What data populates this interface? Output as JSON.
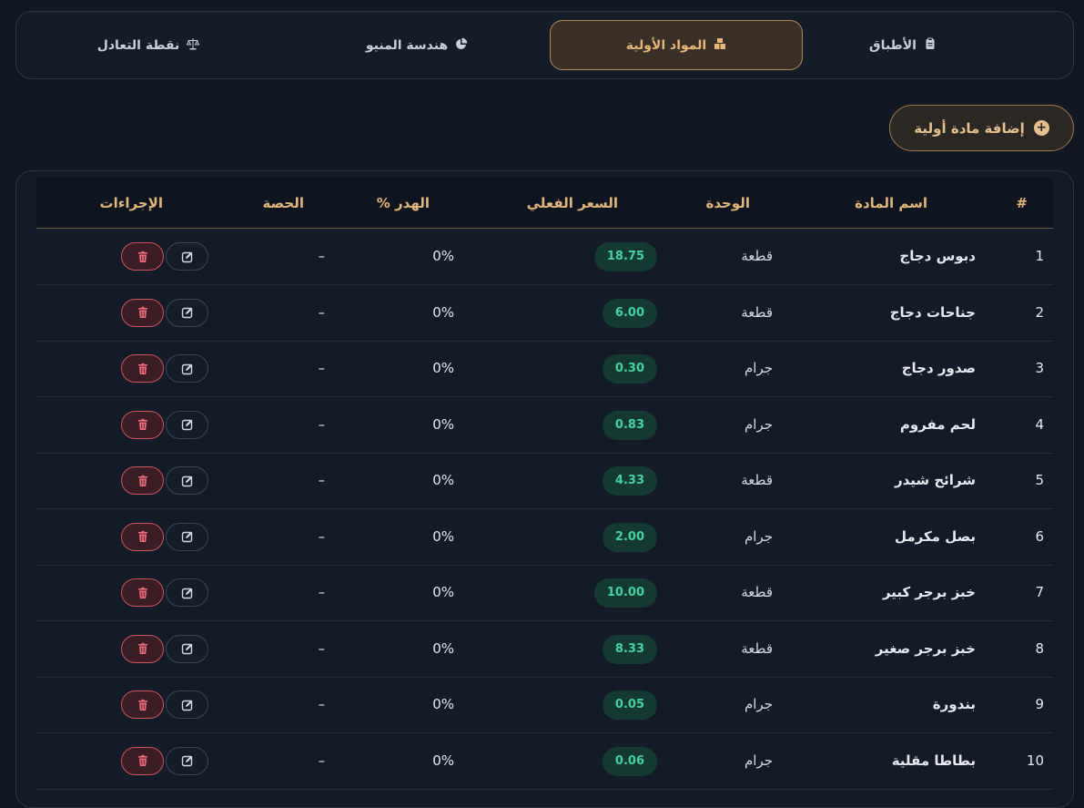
{
  "tabs": [
    {
      "label": "الأطباق",
      "icon": "clipboard-icon"
    },
    {
      "label": "المواد الأولية",
      "icon": "boxes-icon",
      "active": true
    },
    {
      "label": "هندسة المنيو",
      "icon": "pie-chart-icon"
    },
    {
      "label": "نقطة التعادل",
      "icon": "scale-icon"
    }
  ],
  "add_button": {
    "label": "إضافة مادة أولية",
    "icon": "plus-circle-icon"
  },
  "table": {
    "headers": {
      "index": "#",
      "name": "اسم المادة",
      "unit": "الوحدة",
      "price": "السعر الفعلي",
      "waste": "الهدر %",
      "portion": "الحصة",
      "actions": "الإجراءات"
    },
    "rows": [
      {
        "index": "1",
        "name": "دبوس دجاج",
        "unit": "قطعة",
        "price": "18.75",
        "waste": "0%",
        "portion": "–"
      },
      {
        "index": "2",
        "name": "جناحات دجاج",
        "unit": "قطعة",
        "price": "6.00",
        "waste": "0%",
        "portion": "–"
      },
      {
        "index": "3",
        "name": "صدور دجاج",
        "unit": "جرام",
        "price": "0.30",
        "waste": "0%",
        "portion": "–"
      },
      {
        "index": "4",
        "name": "لحم مفروم",
        "unit": "جرام",
        "price": "0.83",
        "waste": "0%",
        "portion": "–"
      },
      {
        "index": "5",
        "name": "شرائح شيدر",
        "unit": "قطعة",
        "price": "4.33",
        "waste": "0%",
        "portion": "–"
      },
      {
        "index": "6",
        "name": "بصل مكرمل",
        "unit": "جرام",
        "price": "2.00",
        "waste": "0%",
        "portion": "–"
      },
      {
        "index": "7",
        "name": "خبز برجر كبير",
        "unit": "قطعة",
        "price": "10.00",
        "waste": "0%",
        "portion": "–"
      },
      {
        "index": "8",
        "name": "خبز برجر صغير",
        "unit": "قطعة",
        "price": "8.33",
        "waste": "0%",
        "portion": "–"
      },
      {
        "index": "9",
        "name": "بندورة",
        "unit": "جرام",
        "price": "0.05",
        "waste": "0%",
        "portion": "–"
      },
      {
        "index": "10",
        "name": "بطاطا مقلية",
        "unit": "جرام",
        "price": "0.06",
        "waste": "0%",
        "portion": "–"
      }
    ]
  },
  "colors": {
    "accent": "#e2b677",
    "price_text": "#43d39e",
    "price_bg": "#123a33",
    "delete": "#d05060",
    "background": "#111824"
  }
}
